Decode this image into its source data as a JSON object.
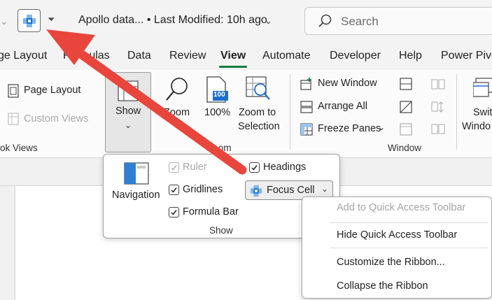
{
  "titlebar": {
    "qat_dropdown_glyph": "⏷",
    "title": "Apollo data... • Last Modified: 10h ago",
    "caret": "⌄",
    "search_placeholder": "Search"
  },
  "tabs": [
    {
      "label": "ge Layout"
    },
    {
      "label": "Formulas"
    },
    {
      "label": "Data"
    },
    {
      "label": "Review"
    },
    {
      "label": "View"
    },
    {
      "label": "Automate"
    },
    {
      "label": "Developer"
    },
    {
      "label": "Help"
    },
    {
      "label": "Power Pivo"
    }
  ],
  "ribbon": {
    "page_layout": "Page Layout",
    "custom_views": "Custom Views",
    "workbook_views_group": "ok Views",
    "show": "Show",
    "zoom": "Zoom",
    "zoom100": "100%",
    "zoom100_icon_text": "100",
    "zoom_to_selection_1": "Zoom to",
    "zoom_to_selection_2": "Selection",
    "zoom_group": "Zoom",
    "new_window": "New Window",
    "arrange_all": "Arrange All",
    "freeze_panes": "Freeze Panes",
    "window_group": "Window",
    "switch_1": "Swit",
    "switch_2": "Windo"
  },
  "show_panel": {
    "navigation": "Navigation",
    "ruler": "Ruler",
    "gridlines": "Gridlines",
    "formula_bar": "Formula Bar",
    "headings": "Headings",
    "focus_cell": "Focus Cell",
    "group_label": "Show"
  },
  "context_menu": {
    "items": [
      {
        "label": "Add to Quick Access Toolbar",
        "enabled": false
      },
      {
        "label": "Hide Quick Access Toolbar",
        "enabled": true
      },
      {
        "label": "Customize the Ribbon...",
        "enabled": true
      },
      {
        "label": "Collapse the Ribbon",
        "enabled": true
      }
    ]
  },
  "colors": {
    "accent_green": "#107c41",
    "arrow_red": "#e8453c",
    "icon_blue": "#1e6fc8"
  }
}
